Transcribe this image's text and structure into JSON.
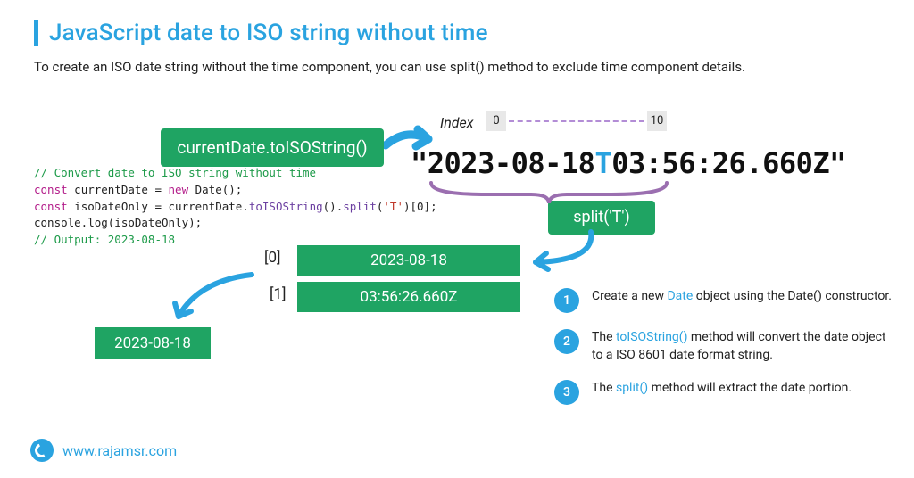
{
  "header": {
    "title": "JavaScript date to ISO string without time",
    "subtitle": "To create an ISO date string without the time component, you can use split() method to exclude time component details."
  },
  "code": {
    "line1": "// Convert date to ISO string without time",
    "line2_kw1": "const",
    "line2_var": " currentDate = ",
    "line2_kw2": "new",
    "line2_rest": " Date();",
    "line3_kw": "const",
    "line3_mid": " isoDateOnly = currentDate.",
    "line3_m1": "toISOString",
    "line3_p1": "().",
    "line3_m2": "split",
    "line3_p2": "(",
    "line3_str": "'T'",
    "line3_p3": ")[0];",
    "line4": "console.log(isoDateOnly);",
    "line5": "// Output: 2023-08-18"
  },
  "pills": {
    "toIso": "currentDate.toISOString()",
    "split": "split('T')"
  },
  "indices": {
    "word": "Index",
    "tick0": "0",
    "tick10": "10",
    "label0": "[0]",
    "label1": "[1]"
  },
  "iso": {
    "pre": "\"2023-08-18",
    "T": "T",
    "post": "03:56:26.660Z\""
  },
  "rows": {
    "r0": "2023-08-18",
    "r1": "03:56:26.660Z"
  },
  "result": "2023-08-18",
  "steps": {
    "s1a": "Create a new ",
    "s1h": "Date",
    "s1b": " object using the Date() constructor.",
    "s2a": "The ",
    "s2h": "toISOString()",
    "s2b": " method will convert the date object to a ISO 8601 date format string.",
    "s3a": "The ",
    "s3h": "split()",
    "s3b": " method will extract the date portion.",
    "n1": "1",
    "n2": "2",
    "n3": "3"
  },
  "footer": {
    "url": "www.rajamsr.com"
  }
}
